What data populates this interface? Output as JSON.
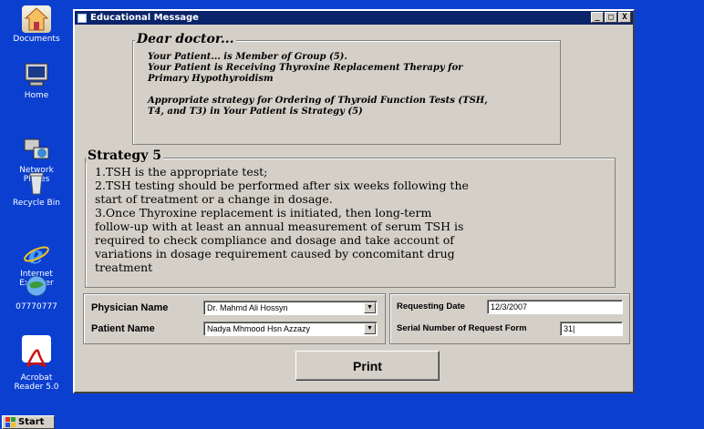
{
  "desktop": {
    "icons": [
      {
        "label": "Documents",
        "icon": "documents-icon"
      },
      {
        "label": "Home",
        "icon": "computer-icon"
      },
      {
        "label": "Network\nPlaces",
        "icon": "network-icon"
      },
      {
        "label": "Recycle Bin",
        "icon": "recycle-bin-icon"
      },
      {
        "label": "Internet\nExplorer",
        "icon": "ie-icon"
      },
      {
        "label": "07770777",
        "icon": "globe-icon"
      },
      {
        "label": "Acrobat\nReader 5.0",
        "icon": "acrobat-icon"
      }
    ]
  },
  "taskbar": {
    "start_label": "Start"
  },
  "window": {
    "title": "Educational Message",
    "min_glyph": "_",
    "max_glyph": "□",
    "close_glyph": "X"
  },
  "message": {
    "heading": "Dear doctor...",
    "line1": "Your Patient... is Member of Group (5).",
    "line2": "Your Patient is Receiving Thyroxine Replacement Therapy for",
    "line3": "Primary Hypothyroidism",
    "line4": "Appropriate strategy for Ordering of Thyroid Function Tests (TSH,",
    "line5": "T4, and T3) in Your Patient is Strategy (5)"
  },
  "strategy": {
    "heading": "Strategy 5",
    "lines": [
      "1.TSH is the appropriate test;",
      "2.TSH testing should be performed after six weeks following the",
      "start of treatment or a change in dosage.",
      "3.Once Thyroxine replacement is initiated, then long-term",
      "follow-up with at least an annual measurement of serum TSH is",
      "required to check compliance and dosage and take account of",
      "variations in dosage requirement caused by concomitant drug",
      "treatment"
    ]
  },
  "form": {
    "physician_label": "Physician Name",
    "physician_value": "Dr. Mahmd Ali Hossyn",
    "patient_label": "Patient Name",
    "patient_value": "Nadya Mhmood Hsn Azzazy",
    "requesting_date_label": "Requesting Date",
    "requesting_date_value": "12/3/2007",
    "serial_label": "Serial Number of Request Form",
    "serial_value": "31|"
  },
  "print_label": "Print",
  "colors": {
    "desktop": "#0b3fd0",
    "titlebar": "#0a246a",
    "window": "#d4d0c8"
  }
}
